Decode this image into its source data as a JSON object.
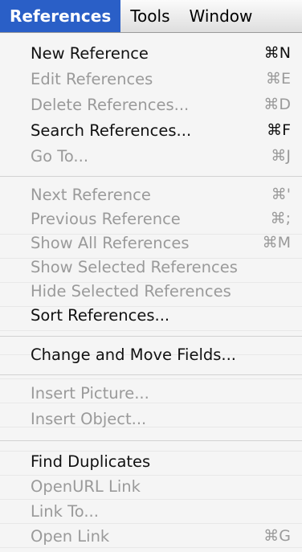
{
  "menubar": [
    "References",
    "Tools",
    "Window"
  ],
  "menu": {
    "items": [
      {
        "label": "New Reference",
        "key": "⌘N",
        "enabled": true
      },
      {
        "label": "Edit References",
        "key": "⌘E",
        "enabled": false
      },
      {
        "label": "Delete References...",
        "key": "⌘D",
        "enabled": false
      },
      {
        "label": "Search References...",
        "key": "⌘F",
        "enabled": true
      },
      {
        "label": "Go To...",
        "key": "⌘J",
        "enabled": false
      },
      {
        "label": "Next Reference",
        "key": "⌘'",
        "enabled": false
      },
      {
        "label": "Previous Reference",
        "key": "⌘;",
        "enabled": false
      },
      {
        "label": "Show All References",
        "key": "⌘M",
        "enabled": false
      },
      {
        "label": "Show Selected References",
        "key": "",
        "enabled": false
      },
      {
        "label": "Hide Selected References",
        "key": "",
        "enabled": false
      },
      {
        "label": "Sort References...",
        "key": "",
        "enabled": true
      },
      {
        "label": "Change and Move Fields...",
        "key": "",
        "enabled": true
      },
      {
        "label": "Insert Picture...",
        "key": "",
        "enabled": false
      },
      {
        "label": "Insert Object...",
        "key": "",
        "enabled": false
      },
      {
        "label": "Find Duplicates",
        "key": "",
        "enabled": true
      },
      {
        "label": "OpenURL Link",
        "key": "",
        "enabled": false
      },
      {
        "label": "Link To...",
        "key": "",
        "enabled": false
      },
      {
        "label": "Open Link",
        "key": "⌘G",
        "enabled": false
      }
    ]
  }
}
